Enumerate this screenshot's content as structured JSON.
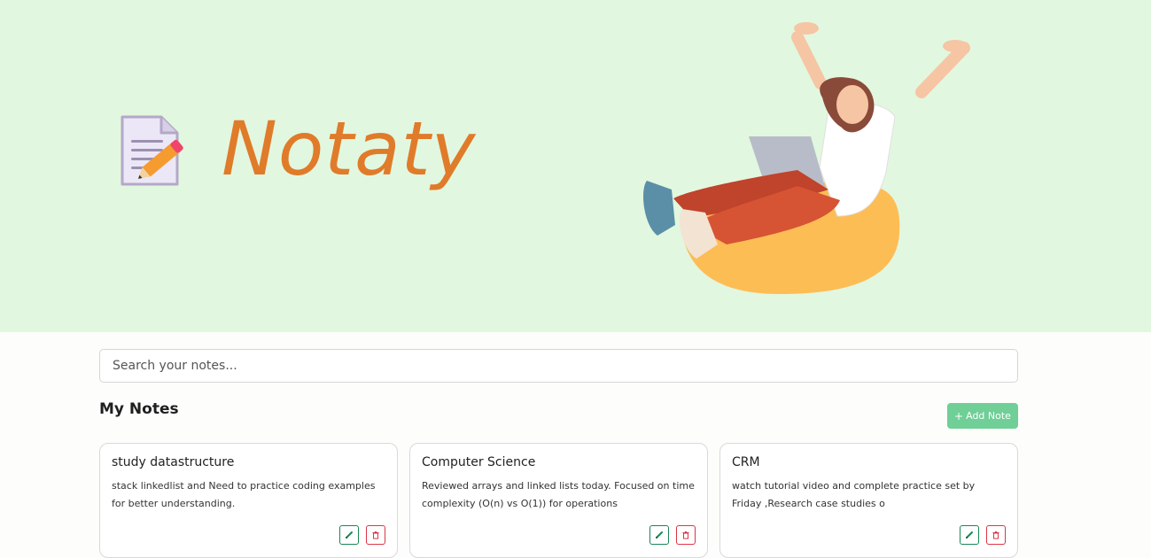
{
  "app": {
    "brand": "Notaty",
    "logo_icon": "memo-pencil-icon",
    "illustration": "woman-on-beanbag-with-laptop"
  },
  "search": {
    "placeholder": "Search your notes..."
  },
  "notes_section": {
    "title": "My Notes",
    "add_label": "Add Note",
    "add_icon": "plus-icon"
  },
  "notes": [
    {
      "title": "study datastructure",
      "body": "stack linkedlist and Need to practice coding examples for better understanding."
    },
    {
      "title": "Computer Science",
      "body": "Reviewed arrays and linked lists today. Focused on time complexity (O(n) vs O(1)) for operations"
    },
    {
      "title": "CRM",
      "body": "watch tutorial video and complete practice set by Friday ,Research case studies o"
    }
  ],
  "colors": {
    "hero_bg": "#e2f7df",
    "brand": "#e07b2a",
    "add_button": "#6fcf97",
    "edit": "#198754",
    "delete": "#dc3545"
  }
}
